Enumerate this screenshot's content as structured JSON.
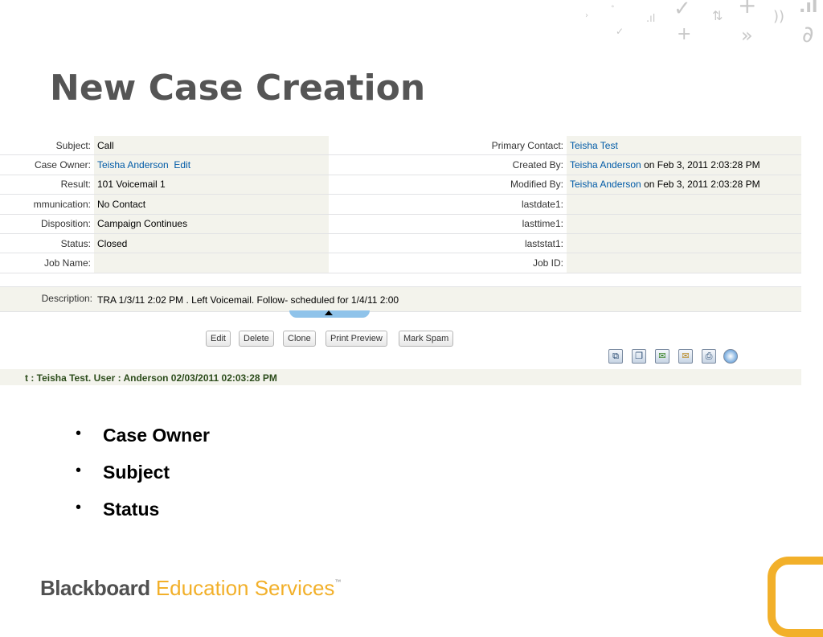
{
  "slide": {
    "title": "New Case Creation",
    "bullets": [
      "Case Owner",
      "Subject",
      "Status"
    ],
    "footer": {
      "brand": "Blackboard",
      "division": "Education Services",
      "mark": "™"
    }
  },
  "case_detail": {
    "left_fields": [
      {
        "label": "Subject:",
        "value": "Call"
      },
      {
        "label": "Case Owner:",
        "value": "Teisha Anderson",
        "action": "Edit"
      },
      {
        "label": "Result:",
        "value": "101 Voicemail 1"
      },
      {
        "label": "mmunication:",
        "value": "No Contact"
      },
      {
        "label": "Disposition:",
        "value": "Campaign Continues"
      },
      {
        "label": "Status:",
        "value": "Closed"
      },
      {
        "label": "Job Name:",
        "value": ""
      }
    ],
    "right_fields": [
      {
        "label": "Primary Contact:",
        "value": "Teisha Test"
      },
      {
        "label": "Created By:",
        "value": "Teisha Anderson",
        "suffix": " on Feb 3, 2011 2:03:28 PM"
      },
      {
        "label": "Modified By:",
        "value": "Teisha Anderson",
        "suffix": " on Feb 3, 2011 2:03:28 PM"
      },
      {
        "label": "lastdate1:",
        "value": ""
      },
      {
        "label": "lasttime1:",
        "value": ""
      },
      {
        "label": "laststat1:",
        "value": ""
      },
      {
        "label": "Job ID:",
        "value": ""
      }
    ],
    "description": {
      "label": "Description:",
      "value": "TRA 1/3/11 2:02 PM . Left Voicemail. Follow- scheduled for 1/4/11 2:00"
    },
    "buttons": {
      "edit": "Edit",
      "delete": "Delete",
      "clone": "Clone",
      "print_preview": "Print Preview",
      "mark_spam": "Mark Spam"
    },
    "toolbar_icons": [
      "open-new-window-icon",
      "copy-icon",
      "email-forward-icon",
      "email-reply-icon",
      "printer-icon",
      "circle-arrow-icon"
    ],
    "history_line": "t : Teisha Test. User : Anderson     02/03/2011 02:03:28 PM"
  },
  "colors": {
    "title": "#555555",
    "link": "#015ba7",
    "field_value_bg": "#f3f3ec",
    "accent_gold": "#f2b02a",
    "tab_marker": "#8fc3ea",
    "history_text": "#2d4d1c"
  }
}
